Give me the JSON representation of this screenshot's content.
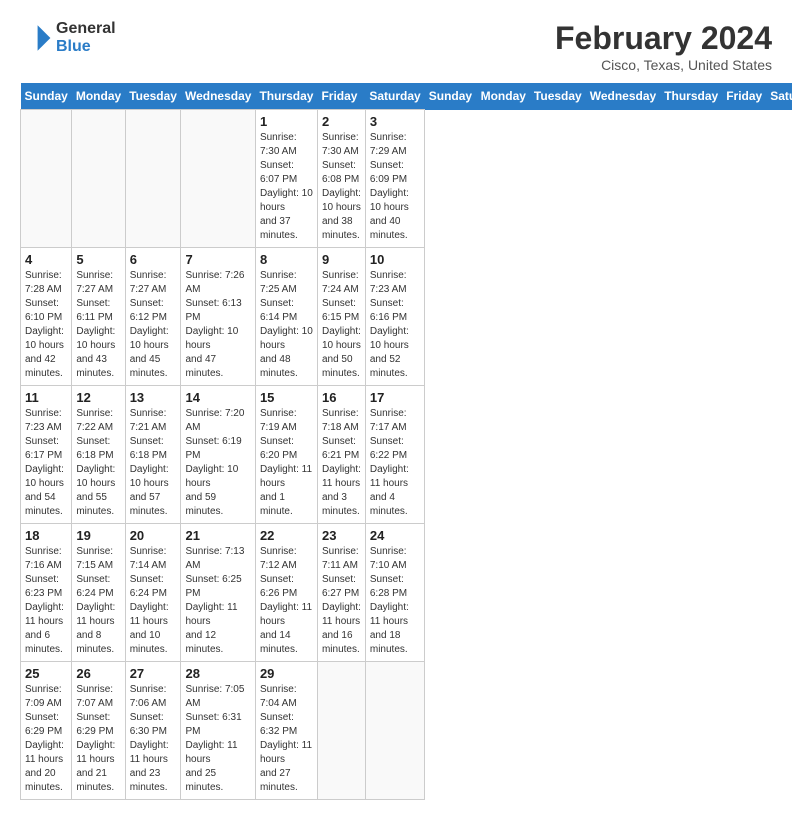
{
  "header": {
    "logo_line1": "General",
    "logo_line2": "Blue",
    "month_title": "February 2024",
    "location": "Cisco, Texas, United States"
  },
  "days_of_week": [
    "Sunday",
    "Monday",
    "Tuesday",
    "Wednesday",
    "Thursday",
    "Friday",
    "Saturday"
  ],
  "weeks": [
    [
      {
        "day": "",
        "info": ""
      },
      {
        "day": "",
        "info": ""
      },
      {
        "day": "",
        "info": ""
      },
      {
        "day": "",
        "info": ""
      },
      {
        "day": "1",
        "info": "Sunrise: 7:30 AM\nSunset: 6:07 PM\nDaylight: 10 hours\nand 37 minutes."
      },
      {
        "day": "2",
        "info": "Sunrise: 7:30 AM\nSunset: 6:08 PM\nDaylight: 10 hours\nand 38 minutes."
      },
      {
        "day": "3",
        "info": "Sunrise: 7:29 AM\nSunset: 6:09 PM\nDaylight: 10 hours\nand 40 minutes."
      }
    ],
    [
      {
        "day": "4",
        "info": "Sunrise: 7:28 AM\nSunset: 6:10 PM\nDaylight: 10 hours\nand 42 minutes."
      },
      {
        "day": "5",
        "info": "Sunrise: 7:27 AM\nSunset: 6:11 PM\nDaylight: 10 hours\nand 43 minutes."
      },
      {
        "day": "6",
        "info": "Sunrise: 7:27 AM\nSunset: 6:12 PM\nDaylight: 10 hours\nand 45 minutes."
      },
      {
        "day": "7",
        "info": "Sunrise: 7:26 AM\nSunset: 6:13 PM\nDaylight: 10 hours\nand 47 minutes."
      },
      {
        "day": "8",
        "info": "Sunrise: 7:25 AM\nSunset: 6:14 PM\nDaylight: 10 hours\nand 48 minutes."
      },
      {
        "day": "9",
        "info": "Sunrise: 7:24 AM\nSunset: 6:15 PM\nDaylight: 10 hours\nand 50 minutes."
      },
      {
        "day": "10",
        "info": "Sunrise: 7:23 AM\nSunset: 6:16 PM\nDaylight: 10 hours\nand 52 minutes."
      }
    ],
    [
      {
        "day": "11",
        "info": "Sunrise: 7:23 AM\nSunset: 6:17 PM\nDaylight: 10 hours\nand 54 minutes."
      },
      {
        "day": "12",
        "info": "Sunrise: 7:22 AM\nSunset: 6:18 PM\nDaylight: 10 hours\nand 55 minutes."
      },
      {
        "day": "13",
        "info": "Sunrise: 7:21 AM\nSunset: 6:18 PM\nDaylight: 10 hours\nand 57 minutes."
      },
      {
        "day": "14",
        "info": "Sunrise: 7:20 AM\nSunset: 6:19 PM\nDaylight: 10 hours\nand 59 minutes."
      },
      {
        "day": "15",
        "info": "Sunrise: 7:19 AM\nSunset: 6:20 PM\nDaylight: 11 hours\nand 1 minute."
      },
      {
        "day": "16",
        "info": "Sunrise: 7:18 AM\nSunset: 6:21 PM\nDaylight: 11 hours\nand 3 minutes."
      },
      {
        "day": "17",
        "info": "Sunrise: 7:17 AM\nSunset: 6:22 PM\nDaylight: 11 hours\nand 4 minutes."
      }
    ],
    [
      {
        "day": "18",
        "info": "Sunrise: 7:16 AM\nSunset: 6:23 PM\nDaylight: 11 hours\nand 6 minutes."
      },
      {
        "day": "19",
        "info": "Sunrise: 7:15 AM\nSunset: 6:24 PM\nDaylight: 11 hours\nand 8 minutes."
      },
      {
        "day": "20",
        "info": "Sunrise: 7:14 AM\nSunset: 6:24 PM\nDaylight: 11 hours\nand 10 minutes."
      },
      {
        "day": "21",
        "info": "Sunrise: 7:13 AM\nSunset: 6:25 PM\nDaylight: 11 hours\nand 12 minutes."
      },
      {
        "day": "22",
        "info": "Sunrise: 7:12 AM\nSunset: 6:26 PM\nDaylight: 11 hours\nand 14 minutes."
      },
      {
        "day": "23",
        "info": "Sunrise: 7:11 AM\nSunset: 6:27 PM\nDaylight: 11 hours\nand 16 minutes."
      },
      {
        "day": "24",
        "info": "Sunrise: 7:10 AM\nSunset: 6:28 PM\nDaylight: 11 hours\nand 18 minutes."
      }
    ],
    [
      {
        "day": "25",
        "info": "Sunrise: 7:09 AM\nSunset: 6:29 PM\nDaylight: 11 hours\nand 20 minutes."
      },
      {
        "day": "26",
        "info": "Sunrise: 7:07 AM\nSunset: 6:29 PM\nDaylight: 11 hours\nand 21 minutes."
      },
      {
        "day": "27",
        "info": "Sunrise: 7:06 AM\nSunset: 6:30 PM\nDaylight: 11 hours\nand 23 minutes."
      },
      {
        "day": "28",
        "info": "Sunrise: 7:05 AM\nSunset: 6:31 PM\nDaylight: 11 hours\nand 25 minutes."
      },
      {
        "day": "29",
        "info": "Sunrise: 7:04 AM\nSunset: 6:32 PM\nDaylight: 11 hours\nand 27 minutes."
      },
      {
        "day": "",
        "info": ""
      },
      {
        "day": "",
        "info": ""
      }
    ]
  ]
}
